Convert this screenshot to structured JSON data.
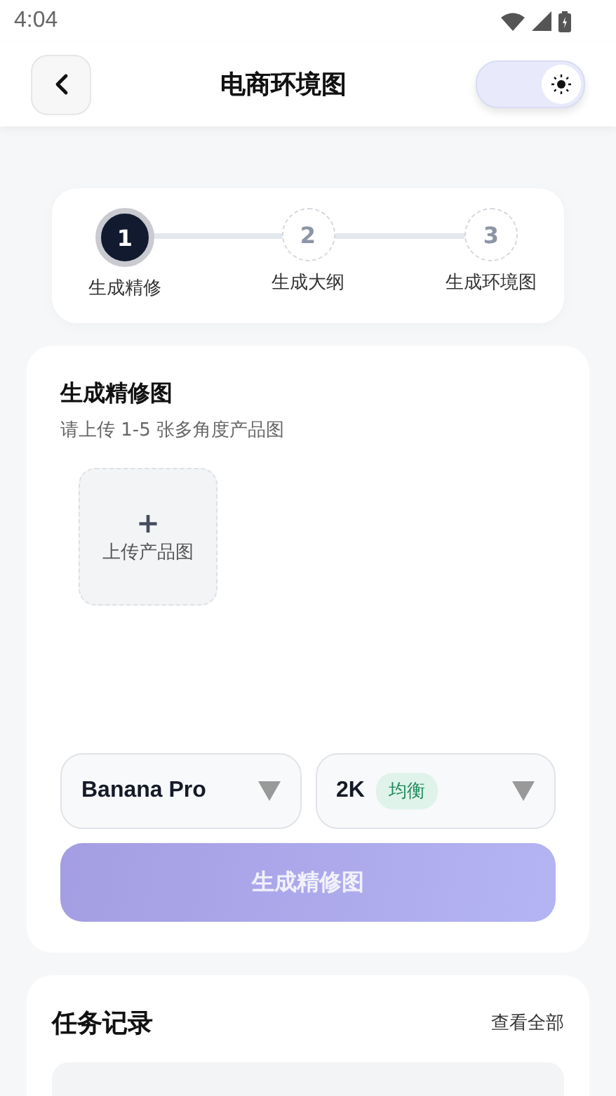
{
  "status_bar": {
    "time": "4:04"
  },
  "header": {
    "title": "电商环境图",
    "theme_toggle": {
      "on": true
    }
  },
  "steps": [
    {
      "number": "1",
      "label": "生成精修",
      "selected": true
    },
    {
      "number": "2",
      "label": "生成大纲",
      "selected": false
    },
    {
      "number": "3",
      "label": "生成环境图",
      "selected": false
    }
  ],
  "refine_card": {
    "title": "生成精修图",
    "subtitle": "请上传 1-5 张多角度产品图",
    "upload": {
      "symbol": "+",
      "label": "上传产品图"
    },
    "model_select": {
      "value": "Banana Pro"
    },
    "quality_select": {
      "value": "2K",
      "tag": "均衡"
    },
    "submit": {
      "label": "生成精修图",
      "disabled": true
    }
  },
  "tasks_card": {
    "title": "任务记录",
    "link": "查看全部"
  }
}
